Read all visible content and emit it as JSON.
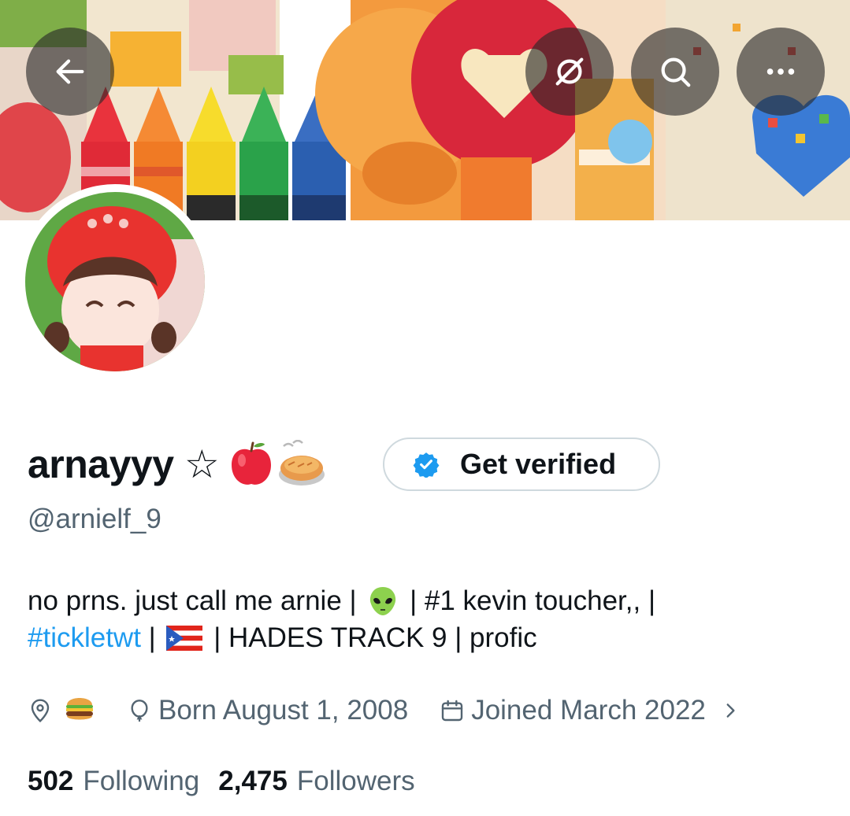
{
  "header": {
    "back_icon": "arrow-left-icon",
    "hide_icon": "eye-slash-icon",
    "search_icon": "search-icon",
    "more_icon": "more-horizontal-icon"
  },
  "profile": {
    "display_name": "arnayyy ☆",
    "name_emojis": [
      "red-apple",
      "pie"
    ],
    "handle": "@arnielf_9",
    "verify_button": "Get verified",
    "bio": {
      "line1_part1": "no prns. just call me arnie | ",
      "line1_emoji": "alien",
      "line1_part2": " | #1 kevin toucher,, |",
      "hashtag": "#tickletwt",
      "line2_sep": " | ",
      "line2_flag": "puerto-rico-flag",
      "line2_rest": " | HADES TRACK 9 | profic"
    },
    "location_emoji": "hamburger",
    "born": "Born August 1, 2008",
    "joined": "Joined March 2022",
    "following_count": "502",
    "following_label": "Following",
    "followers_count": "2,475",
    "followers_label": "Followers"
  },
  "colors": {
    "text_primary": "#0f1419",
    "text_secondary": "#536471",
    "link": "#1d9bf0",
    "border": "#cfd9de"
  }
}
